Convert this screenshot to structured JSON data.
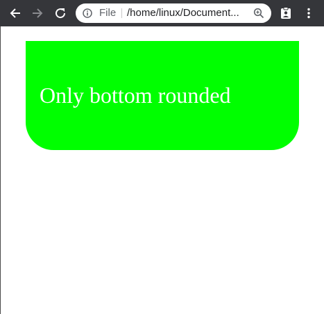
{
  "browser": {
    "back_icon": "arrow-left-icon",
    "forward_icon": "arrow-right-icon",
    "reload_icon": "reload-icon",
    "address": {
      "info_icon": "info-icon",
      "scheme_label": "File",
      "url": "/home/linux/Document...",
      "zoom_icon": "zoom-icon"
    },
    "extension_icon": "clipboard-person-icon",
    "menu_icon": "kebab-menu-icon"
  },
  "content": {
    "box_text": "Only bottom rounded",
    "box_color": "#00ff00",
    "text_color": "#ffffff"
  }
}
